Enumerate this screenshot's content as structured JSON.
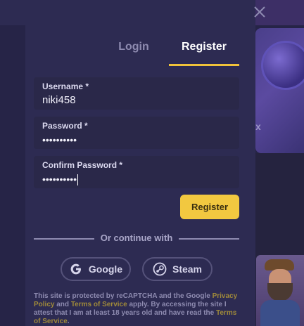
{
  "tabs": {
    "login": "Login",
    "register": "Register"
  },
  "fields": {
    "username": {
      "label": "Username *",
      "value": "niki458"
    },
    "password": {
      "label": "Password *",
      "value": "••••••••••"
    },
    "confirm": {
      "label": "Confirm Password *",
      "value": "••••••••••"
    }
  },
  "register_button": "Register",
  "divider_text": "Or continue with",
  "social": {
    "google": "Google",
    "steam": "Steam"
  },
  "legal": {
    "part1": "This site is protected by reCAPTCHA and the Google ",
    "privacy_link": "Privacy Policy",
    "and": " and ",
    "terms_link": "Terms of Service",
    "part2": " apply. By accessing the site I attest that I am at least 18 years old and have read the ",
    "terms_link2": "Terms of Service",
    "end": "."
  },
  "background": {
    "side_card_mark": "x"
  },
  "colors": {
    "accent": "#f2c840",
    "modal_bg": "#2d2b52",
    "field_bg": "#2a2849",
    "muted": "#8e8bb0"
  },
  "icons": {
    "close": "close-icon",
    "google": "google-icon",
    "steam": "steam-icon"
  }
}
